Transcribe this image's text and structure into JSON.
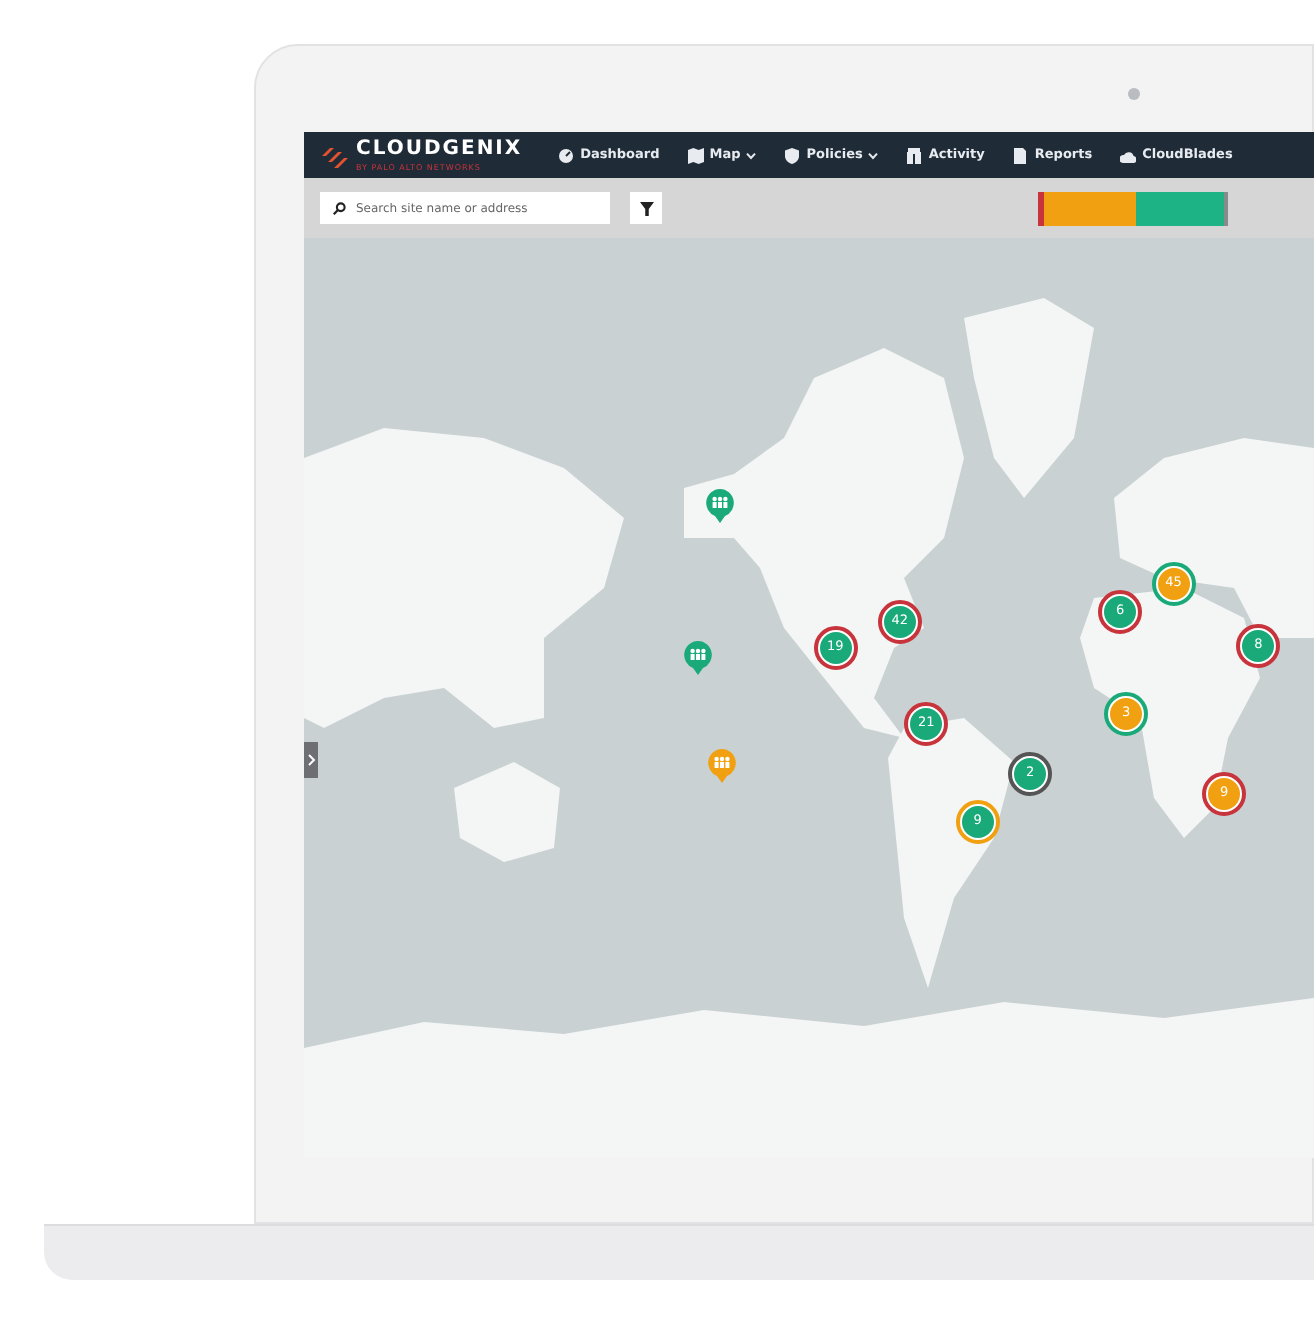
{
  "brand": {
    "name": "CLOUDGENIX",
    "tagline": "BY PALO ALTO NETWORKS"
  },
  "nav": [
    {
      "label": "Dashboard",
      "dropdown": false
    },
    {
      "label": "Map",
      "dropdown": true
    },
    {
      "label": "Policies",
      "dropdown": true
    },
    {
      "label": "Activity",
      "dropdown": false
    },
    {
      "label": "Reports",
      "dropdown": false
    },
    {
      "label": "CloudBlades",
      "dropdown": false
    }
  ],
  "search": {
    "placeholder": "Search site name or address"
  },
  "status_bar": [
    {
      "color": "#c8343c"
    },
    {
      "color": "#f0a010"
    },
    {
      "color": "#1db385"
    },
    {
      "color": "#8a8a8a"
    }
  ],
  "markers": [
    {
      "kind": "pin",
      "color": "#1aaa7a"
    },
    {
      "kind": "pin",
      "color": "#1aaa7a"
    },
    {
      "kind": "pin",
      "color": "#f0a010"
    },
    {
      "kind": "cluster",
      "count": "42",
      "color": "#1aaa7a",
      "ring": {
        "color": "#c8343c"
      }
    },
    {
      "kind": "cluster",
      "count": "19",
      "color": "#1aaa7a",
      "ring": {
        "color": "#c8343c"
      }
    },
    {
      "kind": "cluster",
      "count": "6",
      "color": "#1aaa7a",
      "ring": {
        "color": "#c8343c"
      }
    },
    {
      "kind": "cluster",
      "count": "45",
      "color": "#f0a010",
      "ring": {
        "color": "#1aaa7a"
      }
    },
    {
      "kind": "cluster",
      "count": "8",
      "color": "#1aaa7a",
      "ring": {
        "color": "#c8343c"
      }
    },
    {
      "kind": "cluster",
      "count": "21",
      "color": "#1aaa7a",
      "ring": {
        "color": "#c8343c"
      }
    },
    {
      "kind": "cluster",
      "count": "3",
      "color": "#f0a010",
      "ring": {
        "color": "#1aaa7a"
      }
    },
    {
      "kind": "cluster",
      "count": "2",
      "color": "#1aaa7a",
      "ring": {
        "color": "#555555"
      }
    },
    {
      "kind": "cluster",
      "count": "9",
      "color": "#1aaa7a",
      "ring": {
        "color": "#f0a010"
      }
    },
    {
      "kind": "cluster",
      "count": "9",
      "color": "#f0a010",
      "ring": {
        "color": "#c8343c"
      }
    }
  ]
}
